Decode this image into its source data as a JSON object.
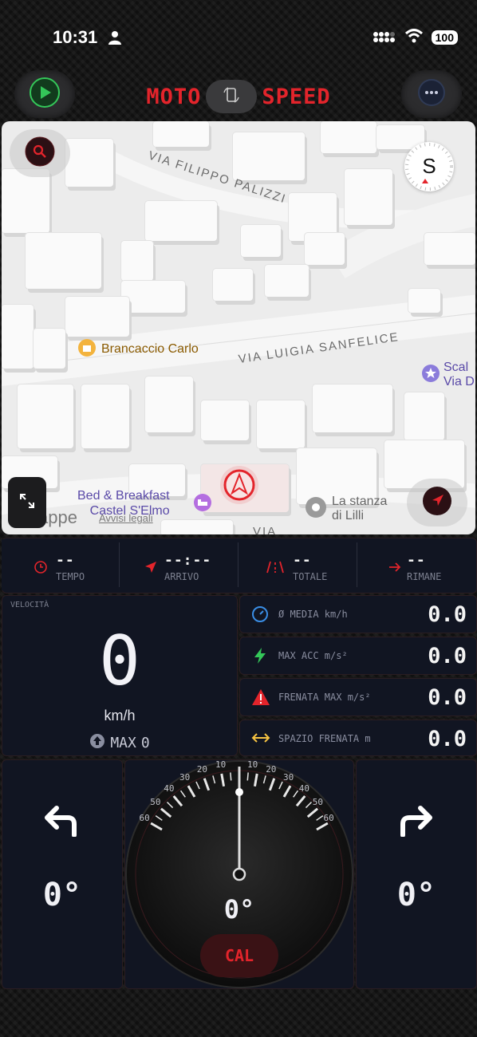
{
  "status": {
    "time": "10:31",
    "battery": "100"
  },
  "header": {
    "title_left": "MOTO",
    "title_right": "SPEED"
  },
  "map": {
    "street_1": "VIA FILIPPO PALIZZI",
    "street_2": "VIA LUIGIA SANFELICE",
    "poi_brancaccio": "Brancaccio Carlo",
    "poi_bnb_line1": "Bed & Breakfast",
    "poi_bnb_line2": "Castel S'Elmo",
    "poi_stanza_line1": "La stanza",
    "poi_stanza_line2": "di Lilli",
    "poi_scal_line1": "Scal",
    "poi_scal_line2": "Via D",
    "maps_brand": "appe",
    "legal": "Avvisi legali",
    "compass": "S",
    "bottom_street": "VIA"
  },
  "info_bar": [
    {
      "value": "--",
      "label": "TEMPO"
    },
    {
      "value": "--:--",
      "label": "ARRIVO"
    },
    {
      "value": "--",
      "label": "TOTALE"
    },
    {
      "value": "--",
      "label": "RIMANE"
    }
  ],
  "speed": {
    "label": "VELOCITÀ",
    "value": "0",
    "unit": "km/h",
    "max_label": "MAX",
    "max_value": "0"
  },
  "stats": [
    {
      "label": "Ø MEDIA km/h",
      "value": "0.0"
    },
    {
      "label": "MAX ACC m/s²",
      "value": "0.0"
    },
    {
      "label": "FRENATA MAX m/s²",
      "value": "0.0"
    },
    {
      "label": "SPAZIO FRENATA m",
      "value": "0.0"
    }
  ],
  "lean": {
    "left_value": "0°",
    "right_value": "0°",
    "center_value": "0°",
    "cal_label": "CAL",
    "scale_labels": [
      "10",
      "20",
      "30",
      "40",
      "50",
      "60"
    ]
  },
  "colors": {
    "accent_red": "#e3242b",
    "panel_bg": "#111522",
    "green": "#34c759",
    "blue": "#3a8ee6",
    "yellow": "#f5c242"
  }
}
